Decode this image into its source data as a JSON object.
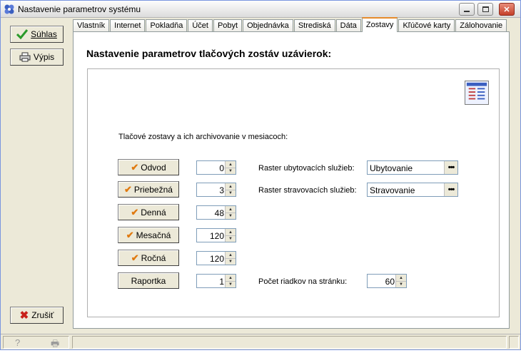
{
  "window": {
    "title": "Nastavenie parametrov systému"
  },
  "sidebar": {
    "suhlas_label": "Súhlas",
    "vypis_label": "Výpis",
    "zrusit_label": "Zrušiť"
  },
  "tabs": [
    "Vlastník",
    "Internet",
    "Pokladňa",
    "Účet",
    "Pobyt",
    "Objednávka",
    "Strediská",
    "Dáta",
    "Zostavy",
    "Kľúčové karty",
    "Zálohovanie"
  ],
  "active_tab": "Zostavy",
  "panel": {
    "heading": "Nastavenie parametrov tlačových zostáv uzávierok:",
    "subheading": "Tlačové zostavy a ich archivovanie v mesiacoch:",
    "reports": [
      {
        "label": "Odvod",
        "checked": true,
        "value": "0"
      },
      {
        "label": "Priebežná",
        "checked": true,
        "value": "3"
      },
      {
        "label": "Denná",
        "checked": true,
        "value": "48"
      },
      {
        "label": "Mesačná",
        "checked": true,
        "value": "120"
      },
      {
        "label": "Ročná",
        "checked": true,
        "value": "120"
      },
      {
        "label": "Raportka",
        "checked": false,
        "value": "1"
      }
    ],
    "raster_ubytovacich_label": "Raster ubytovacích služieb:",
    "raster_ubytovacich_value": "Ubytovanie",
    "raster_stravovacich_label": "Raster stravovacích služieb:",
    "raster_stravovacich_value": "Stravovanie",
    "pocet_riadkov_label": "Počet riadkov na stránku:",
    "pocet_riadkov_value": "60"
  },
  "colors": {
    "active_tab_accent": "#e68b2c",
    "check_color": "#e07a10",
    "cancel_x": "#c8201a",
    "ok_check": "#2a9a2a"
  }
}
